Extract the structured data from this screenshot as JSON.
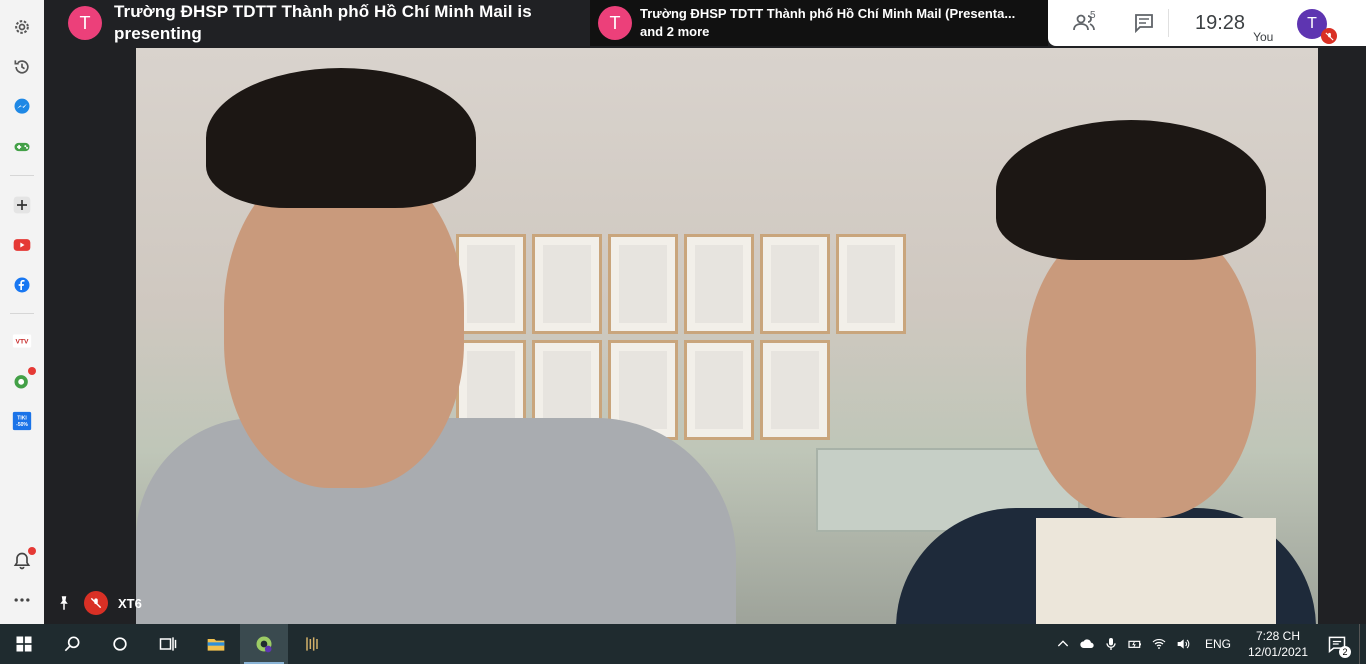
{
  "sidebar": {
    "items": [
      {
        "name": "settings-icon"
      },
      {
        "name": "history-icon"
      },
      {
        "name": "messenger-icon"
      },
      {
        "name": "games-icon"
      },
      {
        "name": "add-icon"
      },
      {
        "name": "youtube-icon"
      },
      {
        "name": "facebook-icon"
      },
      {
        "name": "vtv-go-icon",
        "label": "VTV"
      },
      {
        "name": "coccoc-extension-icon"
      },
      {
        "name": "tiki-icon",
        "label": "TIKI",
        "sublabel": "-50%"
      },
      {
        "name": "bell-icon"
      },
      {
        "name": "more-icon"
      }
    ]
  },
  "meeting": {
    "presenter_avatar": "T",
    "presenter_text": "Trường ĐHSP TDTT Thành phố Hồ Chí Minh Mail is presenting",
    "presentations_avatar": "T",
    "presentations_line1": "Trường ĐHSP TDTT Thành phố Hồ Chí Minh Mail (Presenta...",
    "presentations_line2": "and 2 more",
    "participant_count": "5",
    "time": "19:28",
    "you_label": "You",
    "you_avatar": "T",
    "participant_name": "XT6"
  },
  "taskbar": {
    "language": "ENG",
    "clock_time": "7:28 CH",
    "clock_date": "12/01/2021",
    "notification_count": "2"
  },
  "colors": {
    "presenter_avatar": "#ec407a",
    "you_avatar": "#5e35b1",
    "mic_off": "#d93025",
    "taskbar": "#1f2b2f"
  }
}
